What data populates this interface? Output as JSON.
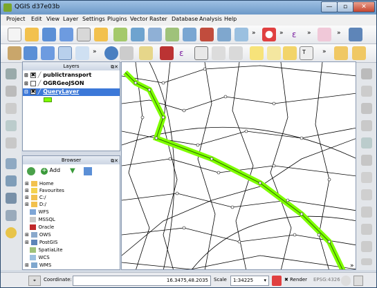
{
  "window": {
    "title": "QGIS d37e03b"
  },
  "menubar": [
    "Project",
    "Edit",
    "View",
    "Layer",
    "Settings",
    "Plugins",
    "Vector",
    "Raster",
    "Database",
    "Analysis",
    "Help"
  ],
  "layers_panel": {
    "title": "Layers",
    "items": [
      {
        "name": "publictransport",
        "visible": true,
        "checked_mark": "✖"
      },
      {
        "name": "OGRGeoJSON",
        "visible": false,
        "checked_mark": ""
      },
      {
        "name": "QueryLayer",
        "visible": true,
        "checked_mark": "✖",
        "selected": true
      }
    ]
  },
  "browser_panel": {
    "title": "Browser",
    "add_label": "Add",
    "items": [
      "Home",
      "Favourites",
      "C:/",
      "D:/",
      "WFS",
      "MSSQL",
      "Oracle",
      "OWS",
      "PostGIS",
      "SpatiaLite",
      "WCS",
      "WMS"
    ]
  },
  "statusbar": {
    "coordinate_label": "Coordinate:",
    "coordinate_value": "16.3475,48.2035",
    "scale_label": "Scale",
    "scale_value": "1:34225",
    "render_label": "Render",
    "crs": "EPSG:4326"
  },
  "colors": {
    "highlight": "#7fff00",
    "selection": "#3c78d8",
    "title_bg": "#6d99c8"
  }
}
